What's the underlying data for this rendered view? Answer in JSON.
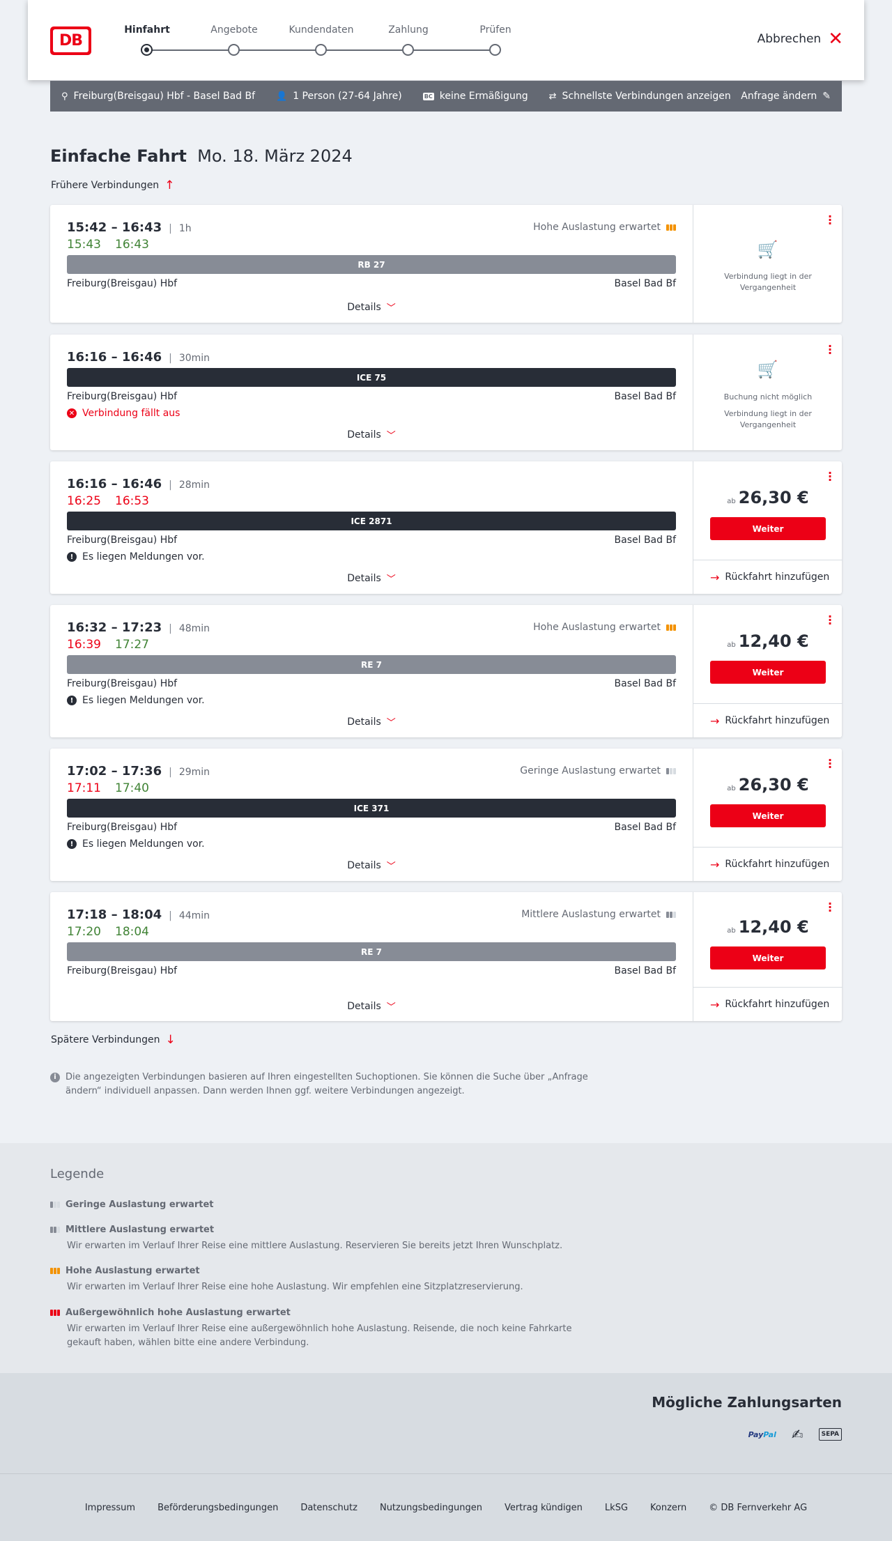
{
  "header": {
    "logo_text": "DB",
    "steps": [
      "Hinfahrt",
      "Angebote",
      "Kundendaten",
      "Zahlung",
      "Prüfen"
    ],
    "cancel_label": "Abbrechen"
  },
  "query": {
    "route": "Freiburg(Breisgau) Hbf - Basel Bad Bf",
    "passengers": "1 Person (27-64 Jahre)",
    "discount_badge": "BC",
    "discount": "keine Ermäßigung",
    "option": "Schnellste Verbindungen anzeigen",
    "change_label": "Anfrage ändern"
  },
  "title": {
    "type": "Einfache Fahrt",
    "date": "Mo. 18. März 2024"
  },
  "earlier_label": "Frühere Verbindungen",
  "later_label": "Spätere Verbindungen",
  "details_label": "Details",
  "return_label": "Rückfahrt hinzufügen",
  "weiter_label": "Weiter",
  "price_prefix": "ab",
  "connections": [
    {
      "times": "15:42 – 16:43",
      "duration": "1h",
      "rt_dep": "15:43",
      "rt_arr": "16:43",
      "occupancy": "Hohe Auslastung erwartet",
      "train": "RB 27",
      "from": "Freiburg(Breisgau) Hbf",
      "to": "Basel Bad Bf",
      "status": "Verbindung liegt in der Vergangenheit"
    },
    {
      "times": "16:16 – 16:46",
      "duration": "30min",
      "train": "ICE 75",
      "from": "Freiburg(Breisgau) Hbf",
      "to": "Basel Bad Bf",
      "message": "Verbindung fällt aus",
      "status_line1": "Buchung nicht möglich",
      "status_line2": "Verbindung liegt in der Vergangenheit"
    },
    {
      "times": "16:16 – 16:46",
      "duration": "28min",
      "rt_dep": "16:25",
      "rt_arr": "16:53",
      "train": "ICE 2871",
      "from": "Freiburg(Breisgau) Hbf",
      "to": "Basel Bad Bf",
      "message": "Es liegen Meldungen vor.",
      "price": "26,30 €"
    },
    {
      "times": "16:32 – 17:23",
      "duration": "48min",
      "rt_dep": "16:39",
      "rt_arr": "17:27",
      "occupancy": "Hohe Auslastung erwartet",
      "train": "RE 7",
      "from": "Freiburg(Breisgau) Hbf",
      "to": "Basel Bad Bf",
      "message": "Es liegen Meldungen vor.",
      "price": "12,40 €"
    },
    {
      "times": "17:02 – 17:36",
      "duration": "29min",
      "rt_dep": "17:11",
      "rt_arr": "17:40",
      "occupancy": "Geringe Auslastung erwartet",
      "train": "ICE 371",
      "from": "Freiburg(Breisgau) Hbf",
      "to": "Basel Bad Bf",
      "message": "Es liegen Meldungen vor.",
      "price": "26,30 €"
    },
    {
      "times": "17:18 – 18:04",
      "duration": "44min",
      "rt_dep": "17:20",
      "rt_arr": "18:04",
      "occupancy": "Mittlere Auslastung erwartet",
      "train": "RE 7",
      "from": "Freiburg(Breisgau) Hbf",
      "to": "Basel Bad Bf",
      "price": "12,40 €"
    }
  ],
  "info_text": "Die angezeigten Verbindungen basieren auf Ihren eingestellten Suchoptionen. Sie können die Suche über „Anfrage ändern“ individuell anpassen. Dann werden Ihnen ggf. weitere Verbindungen angezeigt.",
  "legend": {
    "title": "Legende",
    "items": [
      {
        "title": "Geringe Auslastung erwartet",
        "desc": ""
      },
      {
        "title": "Mittlere Auslastung erwartet",
        "desc": "Wir erwarten im Verlauf Ihrer Reise eine mittlere Auslastung. Reservieren Sie bereits jetzt Ihren Wunschplatz."
      },
      {
        "title": "Hohe Auslastung erwartet",
        "desc": "Wir erwarten im Verlauf Ihrer Reise eine hohe Auslastung. Wir empfehlen eine Sitzplatzreservierung."
      },
      {
        "title": "Außergewöhnlich hohe Auslastung erwartet",
        "desc": "Wir erwarten im Verlauf Ihrer Reise eine außergewöhnlich hohe Auslastung. Reisende, die noch keine Fahrkarte gekauft haben, wählen bitte eine andere Verbindung."
      }
    ]
  },
  "payment": {
    "title": "Mögliche Zahlungsarten",
    "paypal_a": "Pay",
    "paypal_b": "Pal",
    "sepa": "SEPA"
  },
  "footer": [
    "Impressum",
    "Beförderungsbedingungen",
    "Datenschutz",
    "Nutzungsbedingungen",
    "Vertrag kündigen",
    "LkSG",
    "Konzern",
    "© DB Fernverkehr AG"
  ],
  "colors": {
    "accent": "#ec0016",
    "dark": "#282d37",
    "grey": "#646973",
    "green": "#408335",
    "occupancy_high": "#f39200"
  }
}
